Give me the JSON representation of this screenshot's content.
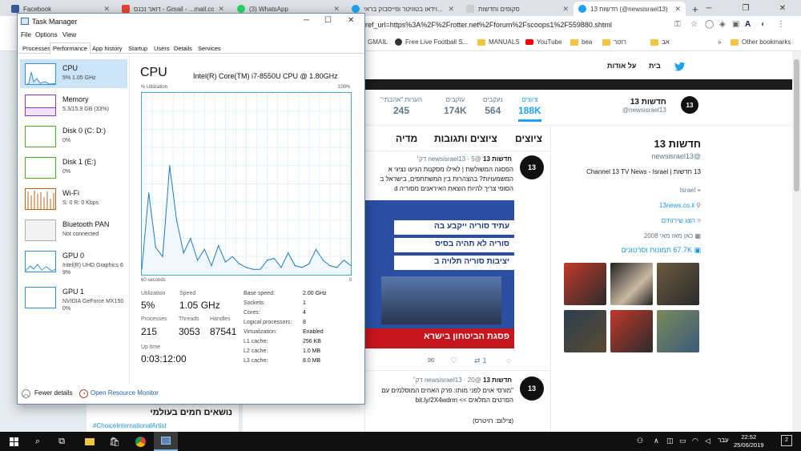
{
  "browser": {
    "tabs": [
      {
        "title": "Facebook",
        "color": "#3b5998"
      },
      {
        "title": "דואר נכנס - Gmail - ‎...mail.com",
        "color": "#ea4335"
      },
      {
        "title": "(3) WhatsApp",
        "color": "#25d366"
      },
      {
        "title": "וידאו בטוויטר ופייסבוק בראי...",
        "color": "#1da1f2"
      },
      {
        "title": "סקופים וחדשות",
        "color": "#cccccc"
      },
      {
        "title": "חדשות 13 (@newsisrael13)",
        "color": "#1da1f2"
      }
    ],
    "url": "ref_url=https%3A%2F%2Frotter.net%2Fforum%2Fscoops1%2F559880.shtml",
    "bookmarks": [
      {
        "label": "Other bookmarks"
      },
      {
        "label": "אב"
      },
      {
        "label": "רוטר"
      },
      {
        "label": "bea"
      },
      {
        "label": "YouTube"
      },
      {
        "label": "MANUALS"
      },
      {
        "label": "Free Live Football S..."
      },
      {
        "label": "GMAIL"
      }
    ]
  },
  "twitter": {
    "nav": {
      "home": "בית",
      "about": "על אודות"
    },
    "stats": [
      {
        "label": "ציוצים",
        "value": "188K"
      },
      {
        "label": "נעקבים",
        "value": "564"
      },
      {
        "label": "עוקבים",
        "value": "174K"
      },
      {
        "label": "\"הערות \"אהבתי",
        "value": "245"
      }
    ],
    "profile": {
      "name": "חדשות 13",
      "handle": "@newsisrael13",
      "bio": "13 חדשות | Channel 13 TV News - Israel",
      "location": "Israel",
      "website": "13news.co.il",
      "services": "הצג שירותים",
      "joined": "כאן מאז מאי 2008",
      "media": "67.7K תמונות וסרטונים",
      "logo_text": "13"
    },
    "timeline_tabs": [
      "ציוצים",
      "ציוצים ותגובות",
      "מדיה"
    ],
    "tweet1": {
      "author": "חדשות 13",
      "handle": "@newsisrael13 · 5 דק׳",
      "text": "הפסגה המשולשת | לאילו מסקנות הגיעו נציגי א המשמעויות? בהצהרות בין המשתתפים, בישראל ב הסופי צריך להיות הוצאת האיראנים מסוריה d",
      "media_lines": [
        "עתיד סוריה ייקבע בה",
        "סוריה לא תהיה בסיס",
        "יציבות סוריה תלויה ב"
      ],
      "media_caption": "פסגת הביטחון בישרא",
      "replies": "1"
    },
    "tweet2": {
      "author": "חדשות 13",
      "handle": "@newsisrael13 · 20 דק׳",
      "text": "\"מורסי אוים לפני מותו: פרק האחים המוסלמים עם הפרטים המלאים >> bit.ly/2X4wdrm",
      "credit": "(צילום: רויטרס)"
    },
    "left_card": {
      "title": "נושאים חמים בעולמי",
      "tag": "#ChoiceInternationalArtist"
    }
  },
  "task_manager": {
    "title": "Task Manager",
    "menu": [
      "File",
      "Options",
      "View"
    ],
    "tabs": [
      "Processes",
      "Performance",
      "App history",
      "Startup",
      "Users",
      "Details",
      "Services"
    ],
    "resources": [
      {
        "name": "CPU",
        "sub": "5% 1.05 GHz",
        "color": "#3a8fd1"
      },
      {
        "name": "Memory",
        "sub": "5.3/15.9 GB (33%)",
        "color": "#8c3ac4"
      },
      {
        "name": "Disk 0 (C: D:)",
        "sub": "0%",
        "color": "#4caf2a"
      },
      {
        "name": "Disk 1 (E:)",
        "sub": "0%",
        "color": "#4caf2a"
      },
      {
        "name": "Wi-Fi",
        "sub": "S: 0 R: 0 Kbps",
        "color": "#b8641d"
      },
      {
        "name": "Bluetooth PAN",
        "sub": "Not connected",
        "color": "#b0b0b0"
      },
      {
        "name": "GPU 0",
        "sub": "Intel(R) UHD Graphics 6",
        "sub2": "9%",
        "color": "#3a8fd1"
      },
      {
        "name": "GPU 1",
        "sub": "NVIDIA GeForce MX150",
        "sub2": "0%",
        "color": "#3a8fd1"
      }
    ],
    "cpu": {
      "heading": "CPU",
      "model": "Intel(R) Core(TM) i7-8550U CPU @ 1.80GHz",
      "axis_label": "% Utilization",
      "axis_max": "100%",
      "axis_time": "60 seconds",
      "axis_min": "0",
      "utilization_label": "Utilization",
      "utilization": "5%",
      "speed_label": "Speed",
      "speed": "1.05 GHz",
      "processes_label": "Processes",
      "processes": "215",
      "threads_label": "Threads",
      "threads": "3053",
      "handles_label": "Handles",
      "handles": "87541",
      "uptime_label": "Up time",
      "uptime": "0:03:12:00",
      "details": [
        {
          "k": "Base speed:",
          "v": "2.00 GHz"
        },
        {
          "k": "Sockets:",
          "v": "1"
        },
        {
          "k": "Cores:",
          "v": "4"
        },
        {
          "k": "Logical processors:",
          "v": "8"
        },
        {
          "k": "Virtualization:",
          "v": "Enabled"
        },
        {
          "k": "L1 cache:",
          "v": "256 KB"
        },
        {
          "k": "L2 cache:",
          "v": "1.0 MB"
        },
        {
          "k": "L3 cache:",
          "v": "8.0 MB"
        }
      ]
    },
    "footer": {
      "fewer": "Fewer details",
      "monitor": "Open Resource Monitor"
    }
  },
  "chart_data": {
    "type": "area",
    "title": "CPU",
    "xlabel": "60 seconds",
    "ylabel": "% Utilization",
    "ylim": [
      0,
      100
    ],
    "x": [
      60,
      58,
      56,
      54,
      52,
      50,
      48,
      46,
      44,
      42,
      40,
      38,
      36,
      34,
      32,
      30,
      28,
      26,
      24,
      22,
      20,
      18,
      16,
      14,
      12,
      10,
      8,
      6,
      4,
      2,
      0
    ],
    "series": [
      {
        "values": [
          3,
          45,
          15,
          10,
          60,
          30,
          12,
          20,
          8,
          14,
          5,
          16,
          7,
          10,
          6,
          4,
          3,
          3,
          8,
          9,
          4,
          12,
          5,
          4,
          6,
          14,
          8,
          5,
          4,
          8,
          5
        ]
      }
    ]
  },
  "taskbar": {
    "time": "22:52",
    "date": "25/06/2019",
    "lang": "עבר",
    "notif": "2"
  }
}
